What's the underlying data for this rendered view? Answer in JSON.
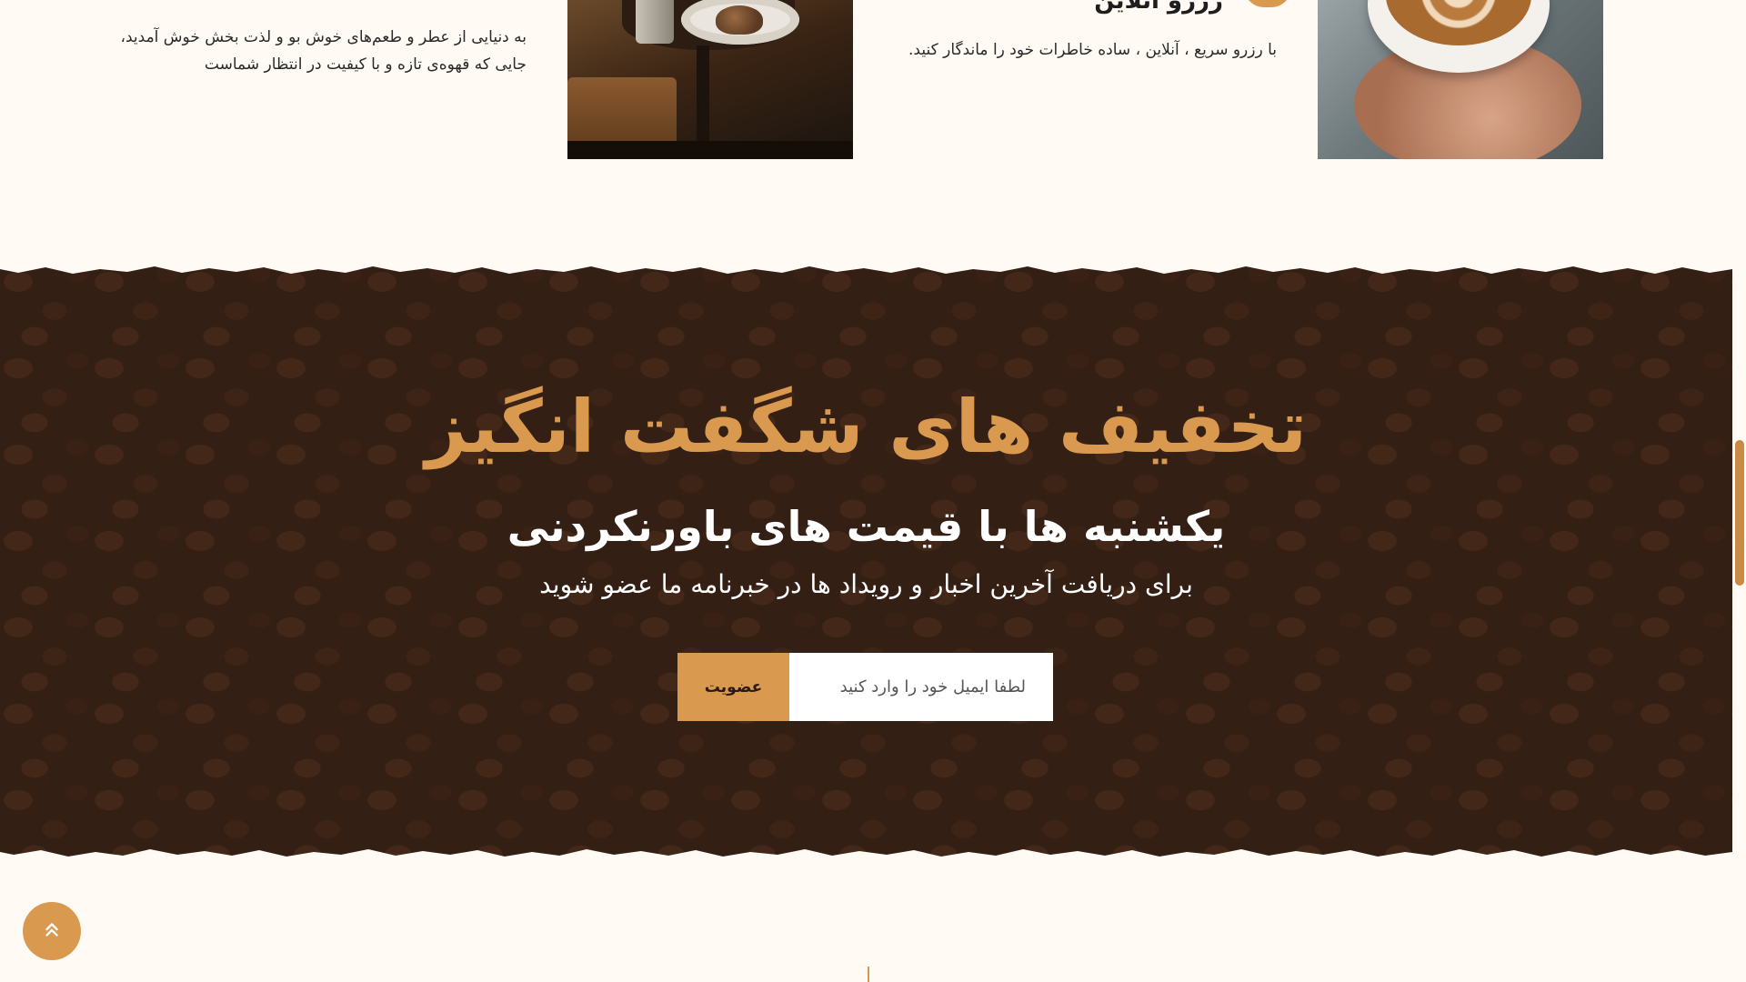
{
  "features": {
    "item1": {
      "description": "به دنیایی از عطر و طعم‌های خوش بو و لذت بخش خوش آمدید، جایی که قهوه‌ی تازه و با کیفیت در انتظار شماست"
    },
    "item2": {
      "title": "رزرو آنلاین",
      "description": "با رزرو سریع ، آنلاین ، ساده خاطرات خود را ماندگار کنید."
    }
  },
  "promo": {
    "title": "تخفیف های شگفت انگیز",
    "subtitle": "یکشنبه ها با قیمت های باورنکردنی",
    "text": "برای دریافت آخرین اخبار و رویداد ها در خبرنامه ما عضو شوید",
    "email_placeholder": "لطفا ایمیل خود را وارد کنید",
    "email_value": "",
    "subscribe_label": "عضویت"
  },
  "icons": {
    "back_to_top": "double-chevron-up-icon"
  },
  "colors": {
    "accent": "#d9994f",
    "page_background": "#fffaf4",
    "banner_background": "#3a2418"
  }
}
